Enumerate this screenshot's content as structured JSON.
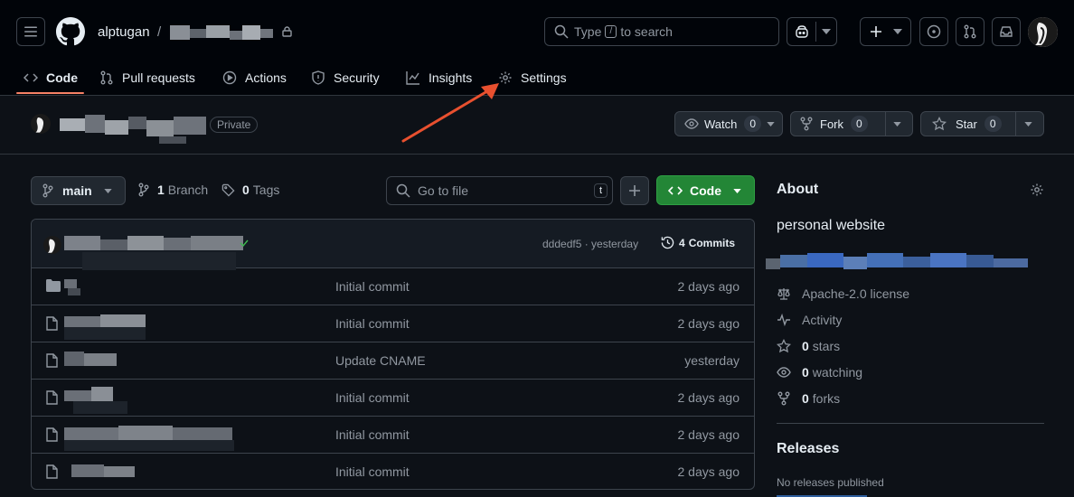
{
  "header": {
    "owner": "alptugan",
    "separator": "/",
    "search_prefix": "Type",
    "search_key": "/",
    "search_suffix": "to search"
  },
  "tabs": [
    {
      "label": "Code",
      "icon": "code-icon"
    },
    {
      "label": "Pull requests",
      "icon": "git-pull-request-icon"
    },
    {
      "label": "Actions",
      "icon": "play-icon"
    },
    {
      "label": "Security",
      "icon": "shield-icon"
    },
    {
      "label": "Insights",
      "icon": "graph-icon"
    },
    {
      "label": "Settings",
      "icon": "gear-icon"
    }
  ],
  "repo": {
    "visibility": "Private",
    "watch_label": "Watch",
    "watch_count": "0",
    "fork_label": "Fork",
    "fork_count": "0",
    "star_label": "Star",
    "star_count": "0"
  },
  "toolbar": {
    "branch": "main",
    "branch_count": "1",
    "branch_label": "Branch",
    "tag_count": "0",
    "tag_label": "Tags",
    "goto_placeholder": "Go to file",
    "goto_key": "t",
    "code_label": "Code"
  },
  "commit": {
    "hash_time": "dddedf5 · yesterday",
    "commits_count": "4",
    "commits_label": "Commits"
  },
  "files": [
    {
      "type": "folder",
      "message": "Initial commit",
      "age": "2 days ago"
    },
    {
      "type": "file",
      "message": "Initial commit",
      "age": "2 days ago"
    },
    {
      "type": "file",
      "message": "Update CNAME",
      "age": "yesterday"
    },
    {
      "type": "file",
      "message": "Initial commit",
      "age": "2 days ago"
    },
    {
      "type": "file",
      "message": "Initial commit",
      "age": "2 days ago"
    },
    {
      "type": "file",
      "message": "Initial commit",
      "age": "2 days ago"
    }
  ],
  "about": {
    "title": "About",
    "description": "personal website",
    "license": "Apache-2.0 license",
    "activity": "Activity",
    "stars_count": "0",
    "stars_label": "stars",
    "watching_count": "0",
    "watching_label": "watching",
    "forks_count": "0",
    "forks_label": "forks",
    "releases_title": "Releases",
    "releases_text": "No releases published"
  },
  "colors": {
    "accent_underline": "#f78166",
    "code_button": "#238636",
    "annotation_arrow": "#e8502f",
    "link_blue": "#4493f8"
  }
}
